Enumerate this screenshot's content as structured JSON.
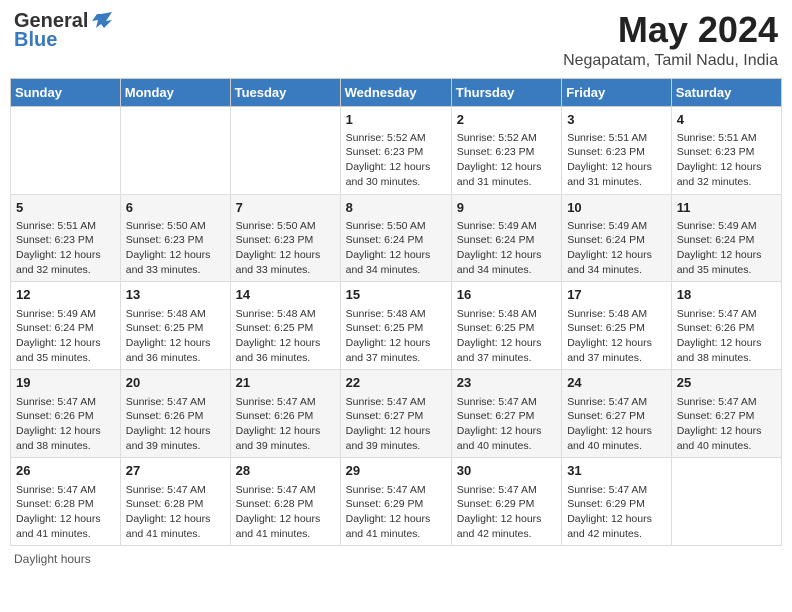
{
  "header": {
    "logo_general": "General",
    "logo_blue": "Blue",
    "month_title": "May 2024",
    "location": "Negapatam, Tamil Nadu, India"
  },
  "weekdays": [
    "Sunday",
    "Monday",
    "Tuesday",
    "Wednesday",
    "Thursday",
    "Friday",
    "Saturday"
  ],
  "weeks": [
    [
      {
        "day": "",
        "info": ""
      },
      {
        "day": "",
        "info": ""
      },
      {
        "day": "",
        "info": ""
      },
      {
        "day": "1",
        "info": "Sunrise: 5:52 AM\nSunset: 6:23 PM\nDaylight: 12 hours and 30 minutes."
      },
      {
        "day": "2",
        "info": "Sunrise: 5:52 AM\nSunset: 6:23 PM\nDaylight: 12 hours and 31 minutes."
      },
      {
        "day": "3",
        "info": "Sunrise: 5:51 AM\nSunset: 6:23 PM\nDaylight: 12 hours and 31 minutes."
      },
      {
        "day": "4",
        "info": "Sunrise: 5:51 AM\nSunset: 6:23 PM\nDaylight: 12 hours and 32 minutes."
      }
    ],
    [
      {
        "day": "5",
        "info": "Sunrise: 5:51 AM\nSunset: 6:23 PM\nDaylight: 12 hours and 32 minutes."
      },
      {
        "day": "6",
        "info": "Sunrise: 5:50 AM\nSunset: 6:23 PM\nDaylight: 12 hours and 33 minutes."
      },
      {
        "day": "7",
        "info": "Sunrise: 5:50 AM\nSunset: 6:23 PM\nDaylight: 12 hours and 33 minutes."
      },
      {
        "day": "8",
        "info": "Sunrise: 5:50 AM\nSunset: 6:24 PM\nDaylight: 12 hours and 34 minutes."
      },
      {
        "day": "9",
        "info": "Sunrise: 5:49 AM\nSunset: 6:24 PM\nDaylight: 12 hours and 34 minutes."
      },
      {
        "day": "10",
        "info": "Sunrise: 5:49 AM\nSunset: 6:24 PM\nDaylight: 12 hours and 34 minutes."
      },
      {
        "day": "11",
        "info": "Sunrise: 5:49 AM\nSunset: 6:24 PM\nDaylight: 12 hours and 35 minutes."
      }
    ],
    [
      {
        "day": "12",
        "info": "Sunrise: 5:49 AM\nSunset: 6:24 PM\nDaylight: 12 hours and 35 minutes."
      },
      {
        "day": "13",
        "info": "Sunrise: 5:48 AM\nSunset: 6:25 PM\nDaylight: 12 hours and 36 minutes."
      },
      {
        "day": "14",
        "info": "Sunrise: 5:48 AM\nSunset: 6:25 PM\nDaylight: 12 hours and 36 minutes."
      },
      {
        "day": "15",
        "info": "Sunrise: 5:48 AM\nSunset: 6:25 PM\nDaylight: 12 hours and 37 minutes."
      },
      {
        "day": "16",
        "info": "Sunrise: 5:48 AM\nSunset: 6:25 PM\nDaylight: 12 hours and 37 minutes."
      },
      {
        "day": "17",
        "info": "Sunrise: 5:48 AM\nSunset: 6:25 PM\nDaylight: 12 hours and 37 minutes."
      },
      {
        "day": "18",
        "info": "Sunrise: 5:47 AM\nSunset: 6:26 PM\nDaylight: 12 hours and 38 minutes."
      }
    ],
    [
      {
        "day": "19",
        "info": "Sunrise: 5:47 AM\nSunset: 6:26 PM\nDaylight: 12 hours and 38 minutes."
      },
      {
        "day": "20",
        "info": "Sunrise: 5:47 AM\nSunset: 6:26 PM\nDaylight: 12 hours and 39 minutes."
      },
      {
        "day": "21",
        "info": "Sunrise: 5:47 AM\nSunset: 6:26 PM\nDaylight: 12 hours and 39 minutes."
      },
      {
        "day": "22",
        "info": "Sunrise: 5:47 AM\nSunset: 6:27 PM\nDaylight: 12 hours and 39 minutes."
      },
      {
        "day": "23",
        "info": "Sunrise: 5:47 AM\nSunset: 6:27 PM\nDaylight: 12 hours and 40 minutes."
      },
      {
        "day": "24",
        "info": "Sunrise: 5:47 AM\nSunset: 6:27 PM\nDaylight: 12 hours and 40 minutes."
      },
      {
        "day": "25",
        "info": "Sunrise: 5:47 AM\nSunset: 6:27 PM\nDaylight: 12 hours and 40 minutes."
      }
    ],
    [
      {
        "day": "26",
        "info": "Sunrise: 5:47 AM\nSunset: 6:28 PM\nDaylight: 12 hours and 41 minutes."
      },
      {
        "day": "27",
        "info": "Sunrise: 5:47 AM\nSunset: 6:28 PM\nDaylight: 12 hours and 41 minutes."
      },
      {
        "day": "28",
        "info": "Sunrise: 5:47 AM\nSunset: 6:28 PM\nDaylight: 12 hours and 41 minutes."
      },
      {
        "day": "29",
        "info": "Sunrise: 5:47 AM\nSunset: 6:29 PM\nDaylight: 12 hours and 41 minutes."
      },
      {
        "day": "30",
        "info": "Sunrise: 5:47 AM\nSunset: 6:29 PM\nDaylight: 12 hours and 42 minutes."
      },
      {
        "day": "31",
        "info": "Sunrise: 5:47 AM\nSunset: 6:29 PM\nDaylight: 12 hours and 42 minutes."
      },
      {
        "day": "",
        "info": ""
      }
    ]
  ],
  "footer": {
    "note": "Daylight hours"
  }
}
